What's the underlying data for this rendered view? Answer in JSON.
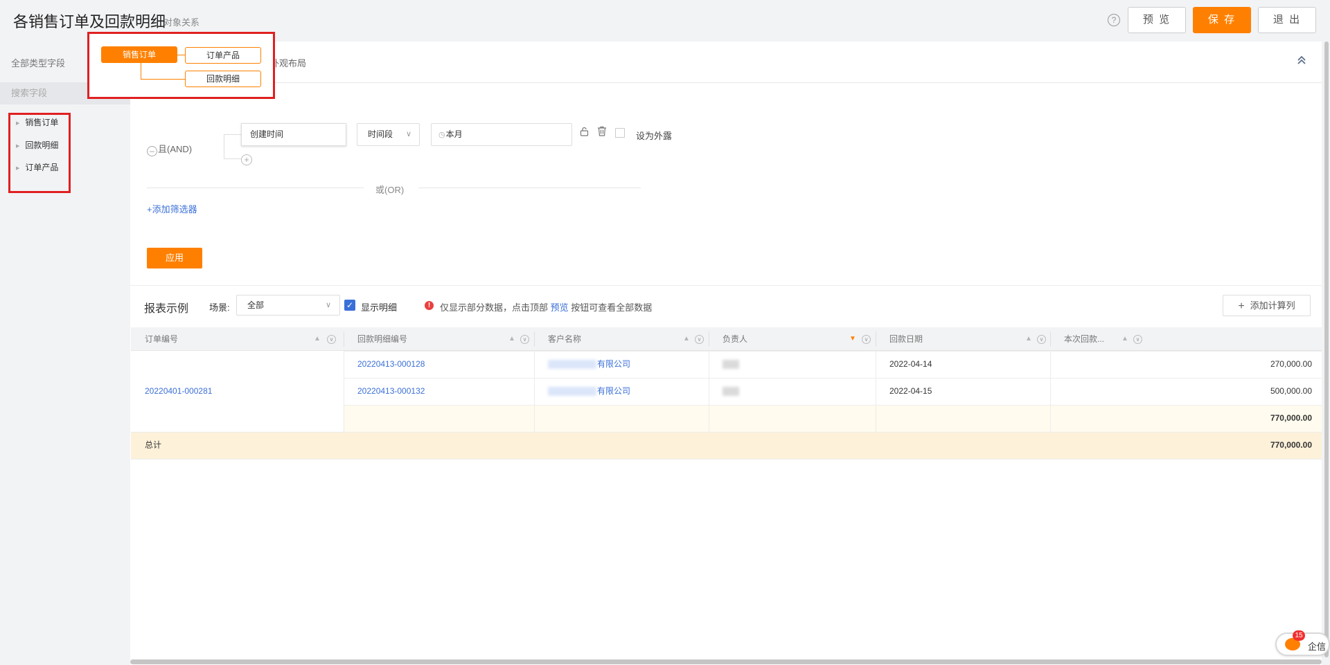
{
  "header": {
    "title": "各销售订单及回款明细",
    "object_relation": "对象关系",
    "help_icon": "?",
    "preview_label": "预 览",
    "save_label": "保 存",
    "exit_label": "退 出"
  },
  "sidebar": {
    "all_fields": "全部类型字段",
    "search_placeholder": "搜索字段",
    "items": [
      {
        "label": "销售订单"
      },
      {
        "label": "回款明细"
      },
      {
        "label": "订单产品"
      }
    ]
  },
  "relation_popup": {
    "root": "销售订单",
    "children": [
      "订单产品",
      "回款明细"
    ]
  },
  "tabs": {
    "layout_partial": "外观布局"
  },
  "filter": {
    "and_label": "且(AND)",
    "field": "创建时间",
    "period_select": "时间段",
    "date_value": "本月",
    "expose_label": "设为外露",
    "or_label": "或(OR)",
    "add_filter": "+添加筛选器",
    "apply_label": "应用"
  },
  "report": {
    "title": "报表示例",
    "scene_label": "场景:",
    "scene_value": "全部",
    "show_detail": "显示明细",
    "show_detail_checked": true,
    "notice_before": "仅显示部分数据，点击顶部",
    "notice_link": "预览",
    "notice_after": "按钮可查看全部数据",
    "add_calc_col": "添加计算列"
  },
  "table": {
    "columns": [
      "订单编号",
      "回款明细编号",
      "客户名称",
      "负责人",
      "回款日期",
      "本次回款..."
    ],
    "order_no": "20220401-000281",
    "rows": [
      {
        "payment_no": "20220413-000128",
        "customer_suffix": "有限公司",
        "date": "2022-04-14",
        "amount": "270,000.00"
      },
      {
        "payment_no": "20220413-000132",
        "customer_suffix": "有限公司",
        "date": "2022-04-15",
        "amount": "500,000.00"
      }
    ],
    "subtotal": "770,000.00",
    "total_label": "总计",
    "total": "770,000.00"
  },
  "chat": {
    "badge": "15",
    "label": "企信"
  },
  "colors": {
    "accent": "#ff8000",
    "link": "#3a6fd8",
    "highlight_border": "#e02020"
  }
}
